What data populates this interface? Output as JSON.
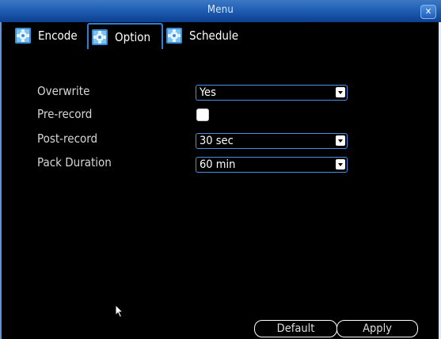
{
  "window": {
    "title": "Menu"
  },
  "tabs": [
    {
      "label": "Encode",
      "icon": "gear-icon"
    },
    {
      "label": "Option",
      "icon": "gear-icon"
    },
    {
      "label": "Schedule",
      "icon": "gear-icon"
    }
  ],
  "active_tab": "Option",
  "fields": {
    "overwrite": {
      "label": "Overwrite",
      "value": "Yes"
    },
    "pre_record": {
      "label": "Pre-record",
      "checked": false
    },
    "post_record": {
      "label": "Post-record",
      "value": "30 sec"
    },
    "pack_duration": {
      "label": "Pack Duration",
      "value": "60 min"
    }
  },
  "buttons": {
    "default_label": "Default",
    "apply_label": "Apply"
  },
  "colors": {
    "accent": "#2f7fd0",
    "titlebar": "#1f5fb4",
    "background": "#000000"
  }
}
